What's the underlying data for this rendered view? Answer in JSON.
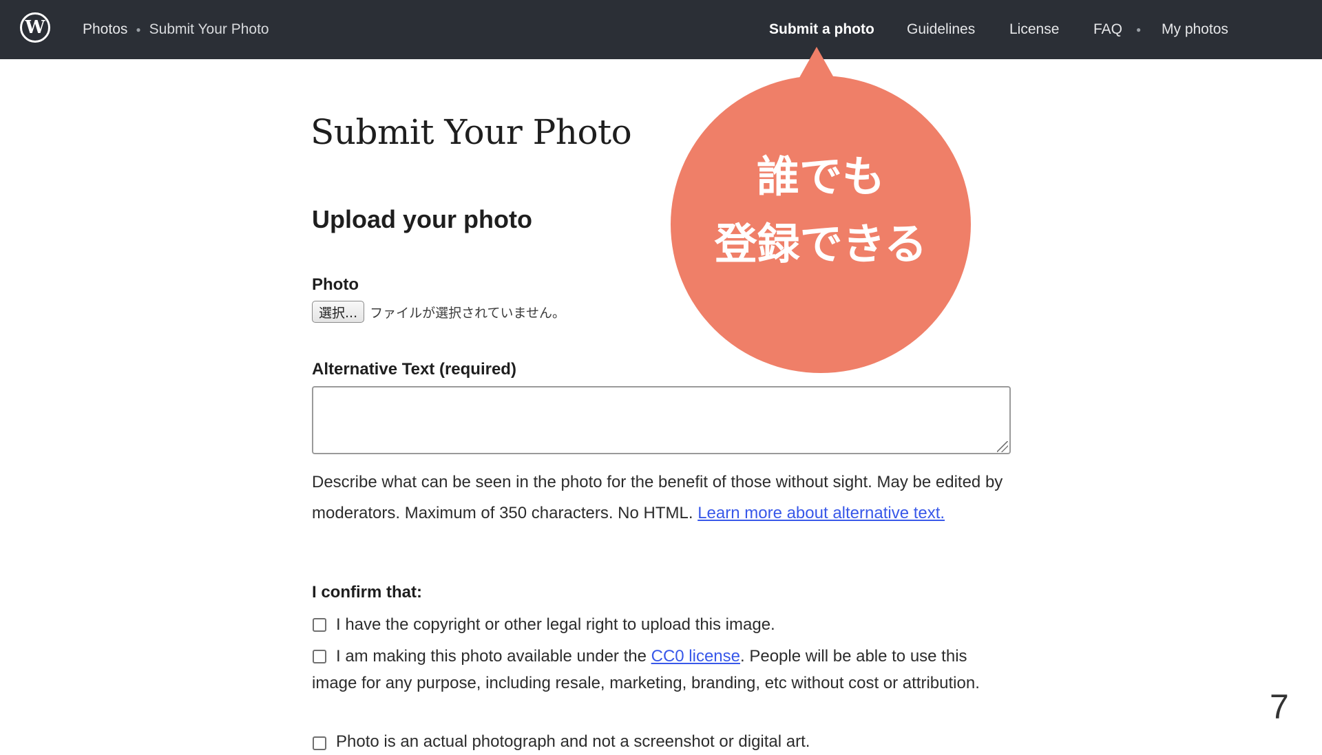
{
  "header": {
    "logo_text": "W",
    "breadcrumb": [
      "Photos",
      "Submit Your Photo"
    ],
    "nav": {
      "submit": "Submit a photo",
      "guidelines": "Guidelines",
      "license": "License",
      "faq": "FAQ",
      "my_photos": "My photos"
    }
  },
  "main": {
    "title": "Submit Your Photo",
    "section_title": "Upload your photo",
    "photo": {
      "label": "Photo",
      "button_label": "選択...",
      "status": "ファイルが選択されていません。"
    },
    "alt_text": {
      "label": "Alternative Text (required)",
      "value": "",
      "help_prefix": "Describe what can be seen in the photo for the benefit of those without sight. May be edited by moderators. Maximum of 350 characters. No HTML. ",
      "help_link": "Learn more about alternative text."
    },
    "confirm": {
      "label": "I confirm that:",
      "item1": "I have the copyright or other legal right to upload this image.",
      "item2_prefix": "I am making this photo available under the ",
      "item2_link": "CC0 license",
      "item2_suffix": ". People will be able to use this image for any purpose, including resale, marketing, branding, etc without cost or attribution.",
      "item3": "Photo is an actual photograph and not a screenshot or digital art."
    }
  },
  "callout": {
    "line1": "誰でも",
    "line2": "登録できる"
  },
  "slide_number": "7",
  "colors": {
    "topbar_bg": "#2b2f36",
    "link": "#3858e9",
    "callout_bg": "#ef7f68"
  }
}
